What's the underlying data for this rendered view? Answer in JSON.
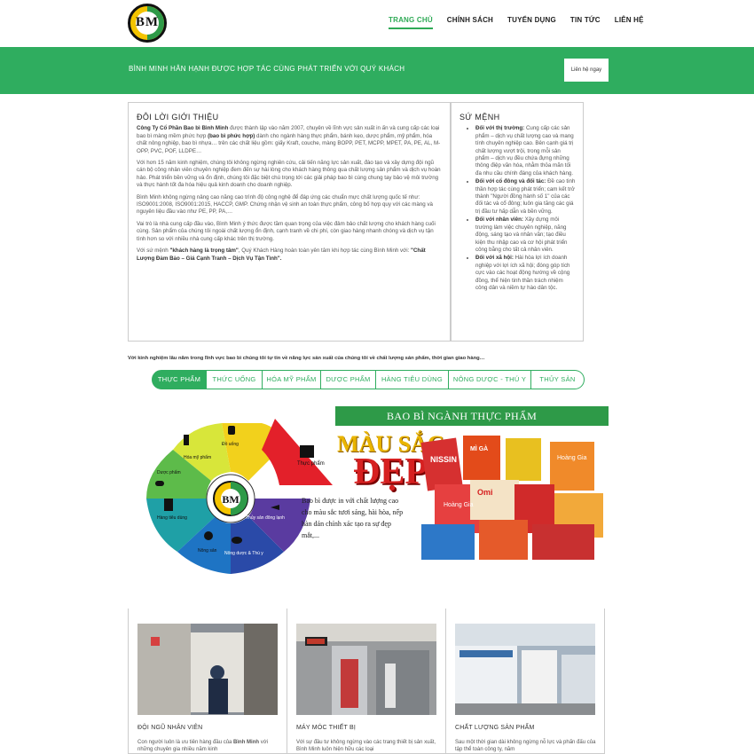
{
  "logo": {
    "letters": "BM"
  },
  "nav": [
    "TRANG CHỦ",
    "CHÍNH SÁCH",
    "TUYỂN DỤNG",
    "TIN TỨC",
    "LIÊN HỆ"
  ],
  "banner": {
    "message": "BÌNH MINH HÂN HẠNH ĐƯỢC HỢP TÁC CÙNG PHÁT TRIỂN VỚI QUÝ KHÁCH",
    "button": "Liên hệ ngay"
  },
  "intro": {
    "title": "ĐÔI LỜI GIỚI THIỆU",
    "p1_company": "Công Ty Cổ Phần Bao bì Bình Minh",
    "p1_rest": " được thành lập vào năm 2007, chuyên về lĩnh vực sản xuất in ấn và cung cấp các loại bao bì màng mềm phức hợp ",
    "p1_bold2": "(bao bì phức hợp)",
    "p1_end": " dành cho ngành hàng thực phẩm, bánh kẹo, dược phẩm, mỹ phẩm, hóa chất nông nghiệp, bao bì nhựa… trên các chất liệu gồm: giấy Kraft, couche, màng BOPP, PET, MCPP, MPET, PA, PE, AL, M-OPP, PVC, POF, LLDPE…",
    "p2": "Với hơn 15 năm kinh nghiệm, chúng tôi không ngừng nghiên cứu, cải tiến năng lực sản xuất, đào tạo và xây dựng đội ngũ cán bộ công nhân viên chuyên nghiệp đem đến sự hài lòng cho khách hàng thông qua chất lượng sản phẩm và dịch vụ hoàn hảo. Phát triển bền vững và ổn định, chúng tôi đặc biệt chú trọng tới các giải pháp bao bì cùng chung tay bảo vệ môi trường và thực hành tốt đa hóa hiệu quả kinh doanh cho doanh nghiệp.",
    "p3": "Bình Minh không ngừng nâng cao năng cao trình độ công nghệ để đáp ứng các chuẩn mực chất lượng quốc tế như: ISO9001:2008, ISO9001:2015, HACCP, GMP. Chứng nhận vệ sinh an toàn thực phẩm, công bố hợp quy với các màng và nguyên liệu đầu vào như PE, PP, PA,…",
    "p4": "Vai trò là nhà cung cấp đầu vào, Bình Minh ý thức được tầm quan trọng của việc đảm bảo chất lượng cho khách hàng cuối cùng. Sản phẩm của chúng tôi ngoài chất lượng ổn định, cạnh tranh về chi phí, còn giao hàng nhanh chóng và dịch vụ tận tình hơn so với nhiều nhà cung cấp khác trên thị trường.",
    "p5_start": "Với sứ mệnh ",
    "p5_bold": "\"khách hàng là trọng tâm\"",
    "p5_mid": ", Quý Khách Hàng hoàn toàn yên tâm khi hợp tác cùng Bình Minh với: ",
    "p5_bold2": "\"Chất Lượng Đảm Bảo – Giá Cạnh Tranh – Dịch Vụ Tận Tình\"."
  },
  "mission": {
    "title": "SỨ MỆNH",
    "items": [
      {
        "head": "Đối với thị trường:",
        "text": " Cung cấp các sản phẩm – dịch vụ chất lượng cao và mang tính chuyên nghiệp cao. Bên cạnh giá trị chất lượng vượt trội, trong mỗi sản phẩm – dịch vụ đều chứa đựng những thông điệp văn hóa, nhằm thỏa mãn tối đa nhu cầu chính đáng của khách hàng."
      },
      {
        "head": "Đối với cổ đông và đối tác:",
        "text": " Đề cao tinh thần hợp tác cùng phát triển; cam kết trở thành \"Người đồng hành số 1\" của các đối tác và cổ đông; luôn gia tăng các giá trị đầu tư hấp dẫn và bền vững."
      },
      {
        "head": "Đối với nhân viên:",
        "text": " Xây dựng môi trường làm việc chuyên nghiệp, năng động, sáng tạo và nhân văn; tạo điều kiện thu nhập cao và cơ hội phát triển công bằng cho tất cả nhân viên."
      },
      {
        "head": "Đối với xã hội:",
        "text": " Hài hòa lợi ích doanh nghiệp với lợi ích xã hội; đóng góp tích cực vào các hoạt động hướng về cộng đồng, thể hiện tinh thần trách nhiệm công dân và niềm tự hào dân tộc."
      }
    ]
  },
  "tagline": "Với kinh nghiệm lâu năm trong lĩnh vực bao bì chúng tôi tự tin về năng lực sản xuất của chúng tôi về chất lượng sản phẩm, thời gian giao hàng…",
  "tabs": [
    "THỰC PHẨM",
    "THỨC UỐNG",
    "HÓA MỸ PHẨM",
    "DƯỢC PHẨM",
    "HÀNG TIÊU DÙNG",
    "NÔNG DƯỢC - THÚ Y",
    "THỦY SẢN"
  ],
  "wheel": {
    "center": "BM",
    "segments": [
      "Thực phẩm",
      "Đồ uống",
      "Hóa mỹ phẩm",
      "Dược phẩm",
      "Hàng tiêu dùng",
      "Nông sản",
      "Nông dược & Thú y",
      "Thủy sản đông lạnh"
    ]
  },
  "promo": {
    "title": "BAO BÌ NGÀNH THỰC PHẨM",
    "line1": "MÀU SẮC",
    "line2": "ĐẸP",
    "desc": "Bao bì được in với chất lượng cao cho màu sắc tươi sáng, hài hòa, nếp hàn dán chính xác tạo ra sự đẹp mắt,...",
    "pack_labels": [
      "NISSIN",
      "MÌ GÀ",
      "Hoàng Gia",
      "Omi",
      "Hoàng Gia"
    ]
  },
  "cards": [
    {
      "title": "ĐỘI NGŨ NHÂN VIÊN",
      "text_start": "Con người luôn là ưu tiên hàng đầu của ",
      "text_bold": "Bình Minh",
      "text_end": " với những chuyên gia nhiều năm kinh"
    },
    {
      "title": "MÁY MÓC THIẾT BỊ",
      "text_start": "Với sự đầu tư không ngừng vào các trang thiết bị sản xuất, Bình Minh luôn hiện hữu các loại",
      "text_bold": "",
      "text_end": ""
    },
    {
      "title": "CHẤT LƯỢNG SẢN PHẨM",
      "text_start": "Sau một thời gian dài không ngừng nỗ lực và phấn đấu của tập thể toàn công ty, năm",
      "text_bold": "",
      "text_end": ""
    }
  ],
  "colors": {
    "brand_green": "#2fad5f",
    "logo_yellow": "#f4c400",
    "accent_red": "#d62020"
  }
}
